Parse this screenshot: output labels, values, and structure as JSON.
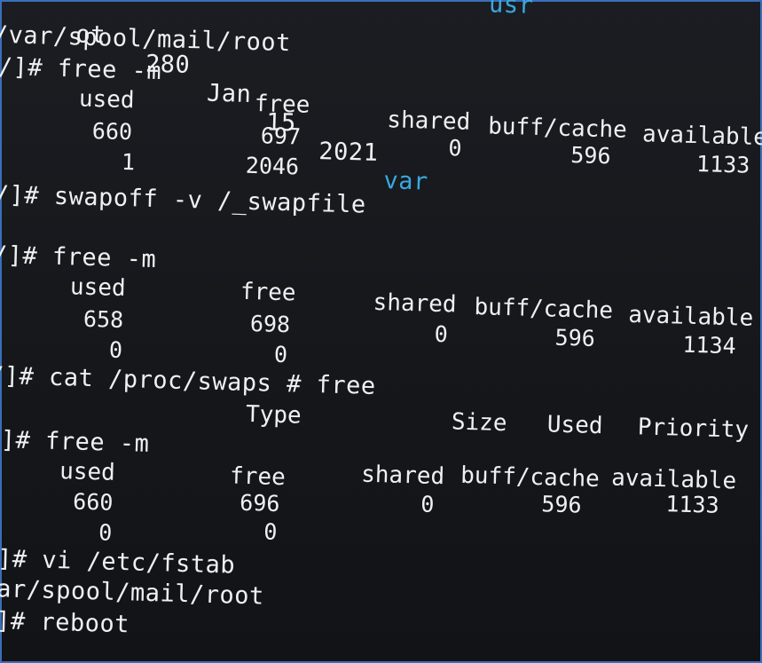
{
  "terminal": {
    "top_line": {
      "prefix": "ot",
      "size": "280",
      "month": "Jan",
      "day": "15",
      "year": "2021",
      "dirname": "var",
      "partial_tail": "usr"
    },
    "mail_notice_1": "/var/spool/mail/root",
    "cmd_free_1": "/]# free -m",
    "free_1": {
      "headers": [
        "used",
        "free",
        "shared",
        "buff/cache",
        "available"
      ],
      "mem": [
        "660",
        "697",
        "0",
        "596",
        "1133"
      ],
      "swap": [
        "1",
        "2046"
      ]
    },
    "cmd_swapoff": "/]# swapoff -v /_swapfile",
    "cmd_free_2": "/]# free -m",
    "free_2": {
      "headers": [
        "used",
        "free",
        "shared",
        "buff/cache",
        "available"
      ],
      "mem": [
        "658",
        "698",
        "0",
        "596",
        "1134"
      ],
      "swap": [
        "0",
        "0"
      ]
    },
    "cmd_cat": "/]# cat /proc/swaps # free",
    "swaps_headers": [
      "Type",
      "Size",
      "Used",
      "Priority"
    ],
    "cmd_free_3": "/]# free -m",
    "free_3": {
      "headers": [
        "used",
        "free",
        "shared",
        "buff/cache",
        "available"
      ],
      "mem": [
        "660",
        "696",
        "0",
        "596",
        "1133"
      ],
      "swap": [
        "0",
        "0"
      ]
    },
    "cmd_vi": "/]# vi /etc/fstab",
    "mail_notice_2": "var/spool/mail/root",
    "cmd_reboot": "/]# reboot"
  }
}
